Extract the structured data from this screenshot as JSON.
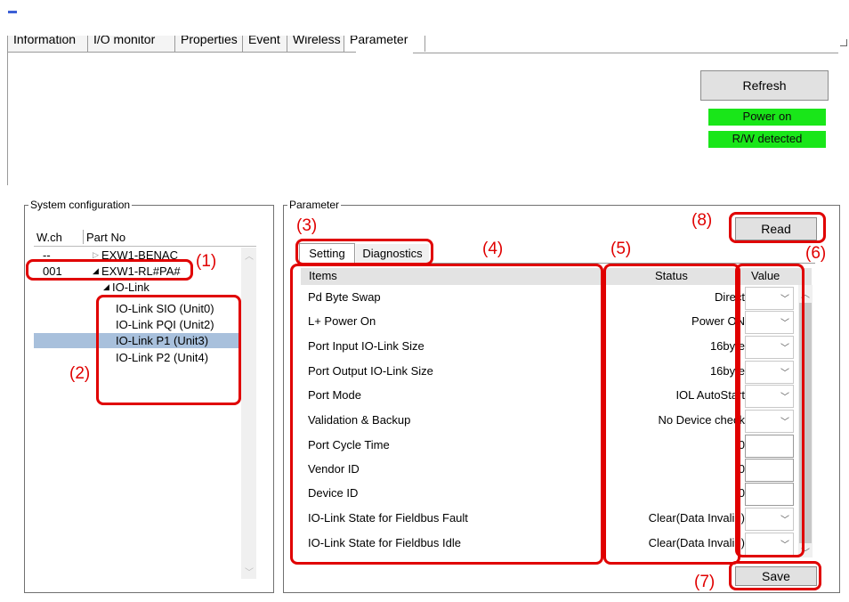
{
  "tabs": [
    {
      "label": "Information",
      "active": false
    },
    {
      "label": "I/O monitor",
      "active": false
    },
    {
      "label": "Properties",
      "active": false
    },
    {
      "label": "Event",
      "active": false
    },
    {
      "label": "Wireless",
      "active": false
    },
    {
      "label": "Parameter",
      "active": true
    }
  ],
  "top": {
    "refresh_label": "Refresh",
    "power_status": "Power on",
    "rw_status": "R/W detected",
    "status_color": "#19e619"
  },
  "system_config": {
    "title": "System configuration",
    "col_wch": "W.ch",
    "col_partno": "Part No",
    "rows": [
      {
        "wch": "--",
        "part": "EXW1-BENAC",
        "expander": "▷"
      },
      {
        "wch": "001",
        "part": "EXW1-RL#PA#",
        "expander": "◢"
      },
      {
        "wch": "",
        "part": "IO-Link",
        "expander": "◢"
      },
      {
        "wch": "",
        "part": "IO-Link SIO (Unit0)",
        "expander": ""
      },
      {
        "wch": "",
        "part": "IO-Link PQI (Unit2)",
        "expander": ""
      },
      {
        "wch": "",
        "part": "IO-Link P1 (Unit3)",
        "expander": "",
        "selected": true
      },
      {
        "wch": "",
        "part": "IO-Link P2 (Unit4)",
        "expander": ""
      }
    ]
  },
  "parameter": {
    "title": "Parameter",
    "read_label": "Read",
    "save_label": "Save",
    "subtabs": [
      "Setting",
      "Diagnostics"
    ],
    "col_items": "Items",
    "col_status": "Status",
    "col_value": "Value",
    "rows": [
      {
        "item": "Pd Byte Swap",
        "status": "Direct",
        "control": "combo"
      },
      {
        "item": "L+ Power On",
        "status": "Power ON",
        "control": "combo"
      },
      {
        "item": "Port Input IO-Link Size",
        "status": "16byte",
        "control": "combo"
      },
      {
        "item": "Port Output IO-Link Size",
        "status": "16byte",
        "control": "combo"
      },
      {
        "item": "Port Mode",
        "status": "IOL AutoStart",
        "control": "combo"
      },
      {
        "item": "Validation & Backup",
        "status": "No Device check",
        "control": "combo"
      },
      {
        "item": "Port Cycle Time",
        "status": "0",
        "control": "text"
      },
      {
        "item": "Vendor ID",
        "status": "0",
        "control": "text"
      },
      {
        "item": "Device ID",
        "status": "0",
        "control": "text"
      },
      {
        "item": "IO-Link State for Fieldbus Fault",
        "status": "Clear(Data Invalid)",
        "control": "combo"
      },
      {
        "item": "IO-Link State for Fieldbus Idle",
        "status": "Clear(Data Invalid)",
        "control": "combo"
      }
    ]
  },
  "annotations": [
    "(1)",
    "(2)",
    "(3)",
    "(4)",
    "(5)",
    "(6)",
    "(7)",
    "(8)"
  ],
  "annotation_color": "#e00000"
}
